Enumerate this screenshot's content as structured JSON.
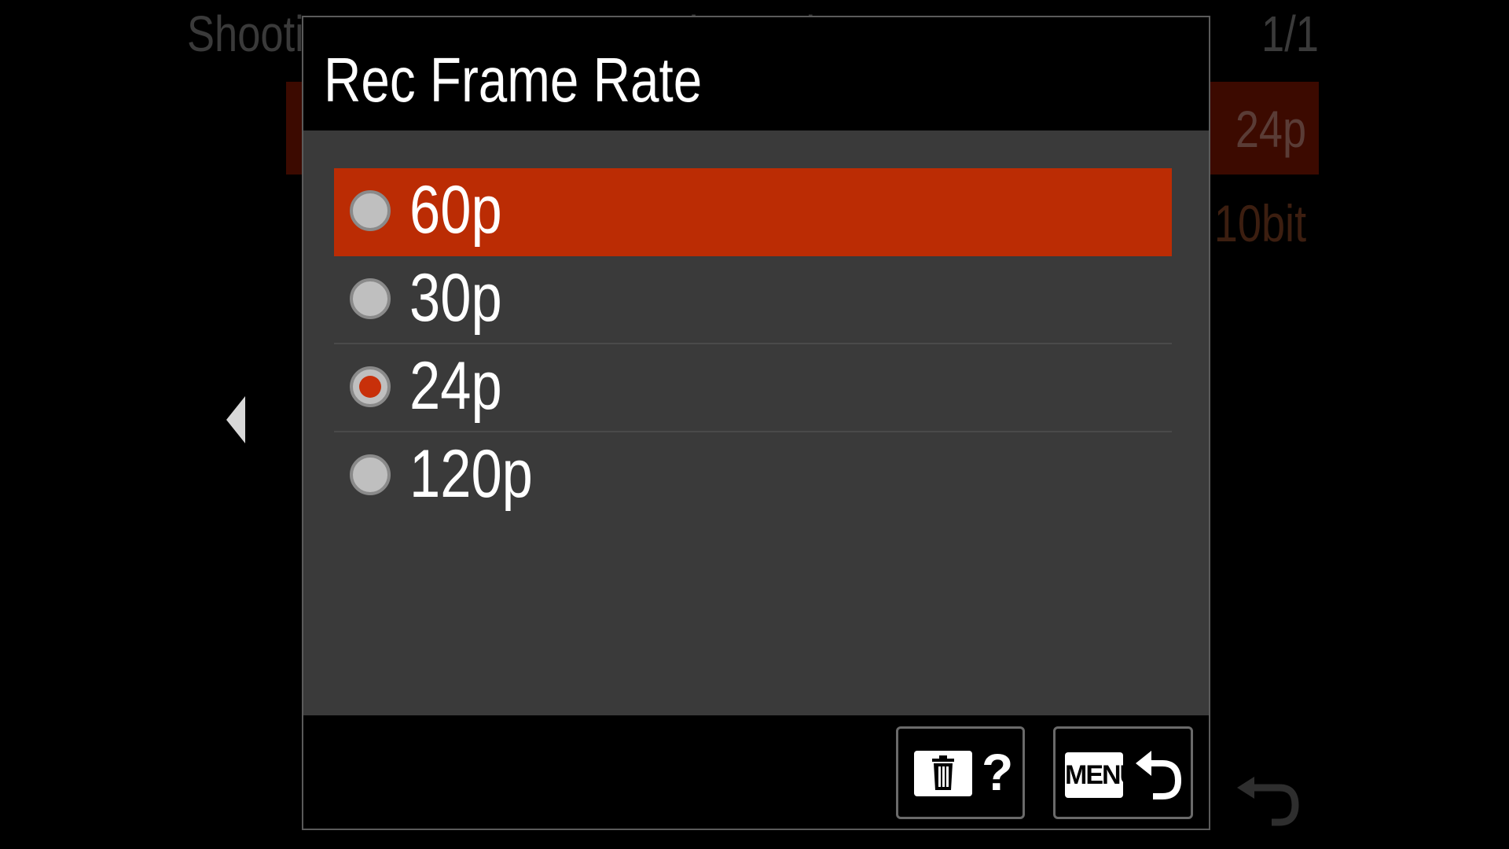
{
  "background": {
    "menu_title": "Shooting ... Camera ... Movie Setting",
    "page_indicator": "1/1",
    "row_values": [
      "24p",
      "10bit"
    ]
  },
  "dialog": {
    "title": "Rec Frame Rate",
    "options": [
      {
        "label": "60p",
        "highlighted": true,
        "checked": false
      },
      {
        "label": "30p",
        "highlighted": false,
        "checked": false
      },
      {
        "label": "24p",
        "highlighted": false,
        "checked": true
      },
      {
        "label": "120p",
        "highlighted": false,
        "checked": false
      }
    ],
    "footer": {
      "help_button": {
        "icons": [
          "trash-icon",
          "question-mark-icon"
        ],
        "question_text": "?"
      },
      "back_button": {
        "menu_text": "MENU",
        "icons": [
          "menu-key-icon",
          "return-arrow-icon"
        ]
      }
    }
  },
  "colors": {
    "highlight": "#bb2c04",
    "radio_checked": "#c8300a",
    "body_bg": "#3a3a3a"
  }
}
